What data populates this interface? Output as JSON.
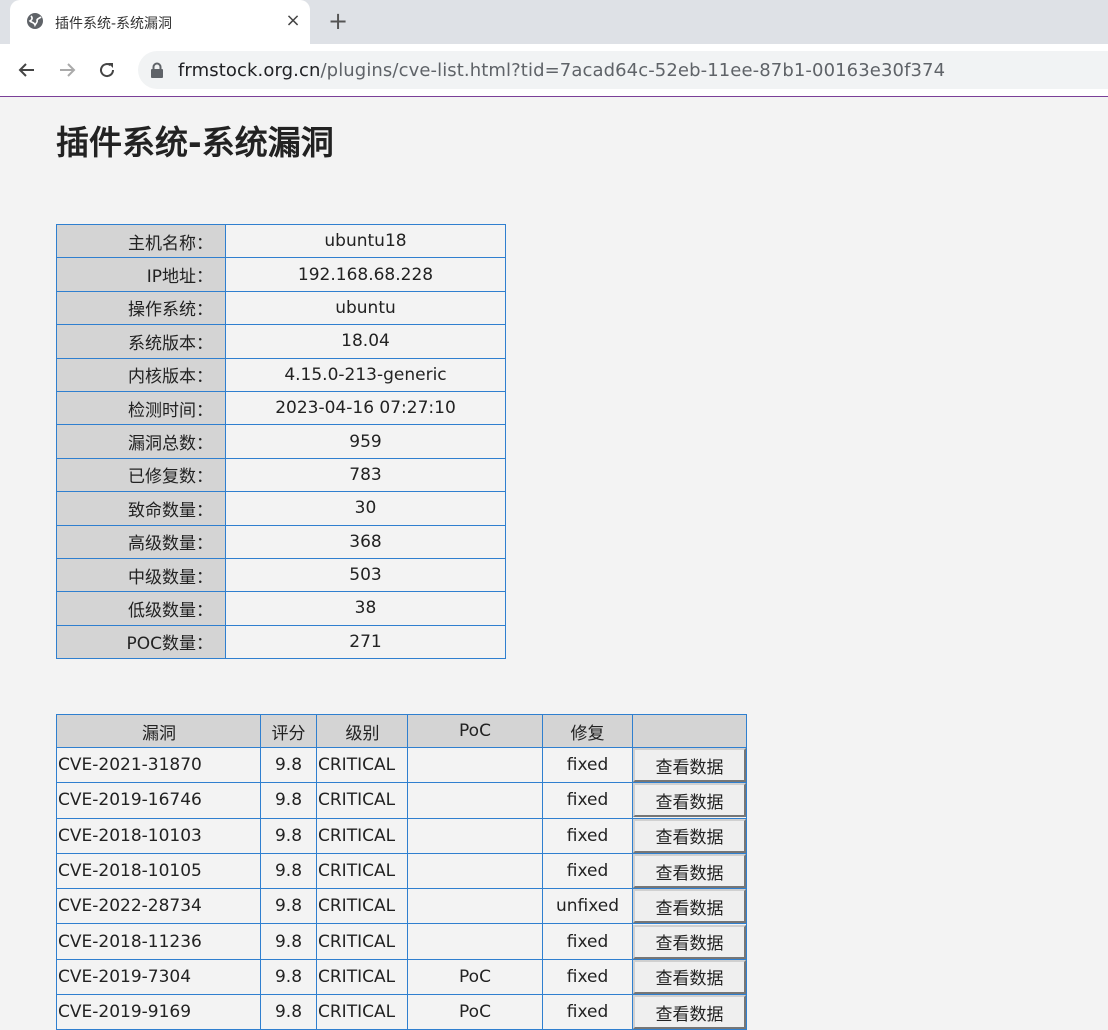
{
  "browser": {
    "tab_title": "插件系统-系统漏洞",
    "new_tab_symbol": "+",
    "close_symbol": "×",
    "url": "frmstock.org.cn/plugins/cve-list.html?tid=7acad64c-52eb-11ee-87b1-00163e30f374",
    "url_domain": "frmstock.org.cn",
    "url_path": "/plugins/cve-list.html?tid=7acad64c-52eb-11ee-87b1-00163e30f374"
  },
  "page": {
    "title": "插件系统-系统漏洞"
  },
  "host_info": [
    {
      "label": "主机名称：",
      "value": "ubuntu18"
    },
    {
      "label": "IP地址：",
      "value": "192.168.68.228"
    },
    {
      "label": "操作系统：",
      "value": "ubuntu"
    },
    {
      "label": "系统版本：",
      "value": "18.04"
    },
    {
      "label": "内核版本：",
      "value": "4.15.0-213-generic"
    },
    {
      "label": "检测时间：",
      "value": "2023-04-16 07:27:10"
    },
    {
      "label": "漏洞总数：",
      "value": "959"
    },
    {
      "label": "已修复数：",
      "value": "783"
    },
    {
      "label": "致命数量：",
      "value": "30"
    },
    {
      "label": "高级数量：",
      "value": "368"
    },
    {
      "label": "中级数量：",
      "value": "503"
    },
    {
      "label": "低级数量：",
      "value": "38"
    },
    {
      "label": "POC数量：",
      "value": "271"
    }
  ],
  "cve_table": {
    "headers": [
      "漏洞",
      "评分",
      "级别",
      "PoC",
      "修复",
      ""
    ],
    "view_button_label": "查看数据",
    "rows": [
      {
        "cve": "CVE-2021-31870",
        "score": "9.8",
        "level": "CRITICAL",
        "poc": "",
        "fix": "fixed"
      },
      {
        "cve": "CVE-2019-16746",
        "score": "9.8",
        "level": "CRITICAL",
        "poc": "",
        "fix": "fixed"
      },
      {
        "cve": "CVE-2018-10103",
        "score": "9.8",
        "level": "CRITICAL",
        "poc": "",
        "fix": "fixed"
      },
      {
        "cve": "CVE-2018-10105",
        "score": "9.8",
        "level": "CRITICAL",
        "poc": "",
        "fix": "fixed"
      },
      {
        "cve": "CVE-2022-28734",
        "score": "9.8",
        "level": "CRITICAL",
        "poc": "",
        "fix": "unfixed"
      },
      {
        "cve": "CVE-2018-11236",
        "score": "9.8",
        "level": "CRITICAL",
        "poc": "",
        "fix": "fixed"
      },
      {
        "cve": "CVE-2019-7304",
        "score": "9.8",
        "level": "CRITICAL",
        "poc": "PoC",
        "fix": "fixed"
      },
      {
        "cve": "CVE-2019-9169",
        "score": "9.8",
        "level": "CRITICAL",
        "poc": "PoC",
        "fix": "fixed"
      }
    ]
  }
}
